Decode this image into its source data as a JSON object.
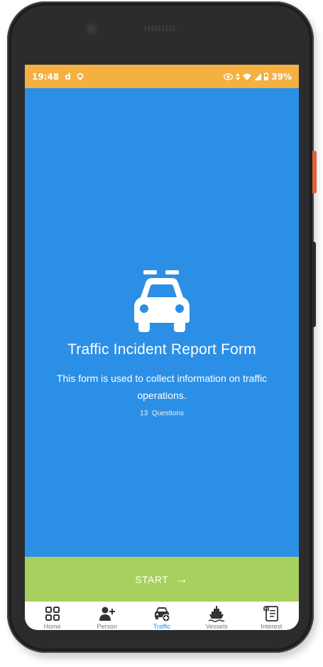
{
  "status_bar": {
    "time": "19:48",
    "carrier_glyph": "d",
    "battery": "39%"
  },
  "form": {
    "title": "Traffic Incident Report Form",
    "description": "This form is used to collect information on traffic operations.",
    "question_count": "13",
    "questions_label": "Questions"
  },
  "start_button": {
    "label": "START",
    "arrow": "→"
  },
  "bottom_nav": {
    "items": [
      {
        "label": "Home",
        "icon": "grid-icon"
      },
      {
        "label": "Person",
        "icon": "add-person-icon"
      },
      {
        "label": "Traffic",
        "icon": "car-add-icon",
        "active": true
      },
      {
        "label": "Vessels",
        "icon": "ship-icon"
      },
      {
        "label": "Interest",
        "icon": "scroll-icon"
      }
    ]
  },
  "colors": {
    "accent": "#2b8fe6",
    "status_bar": "#f4b041",
    "start_button": "#a8d05e"
  }
}
